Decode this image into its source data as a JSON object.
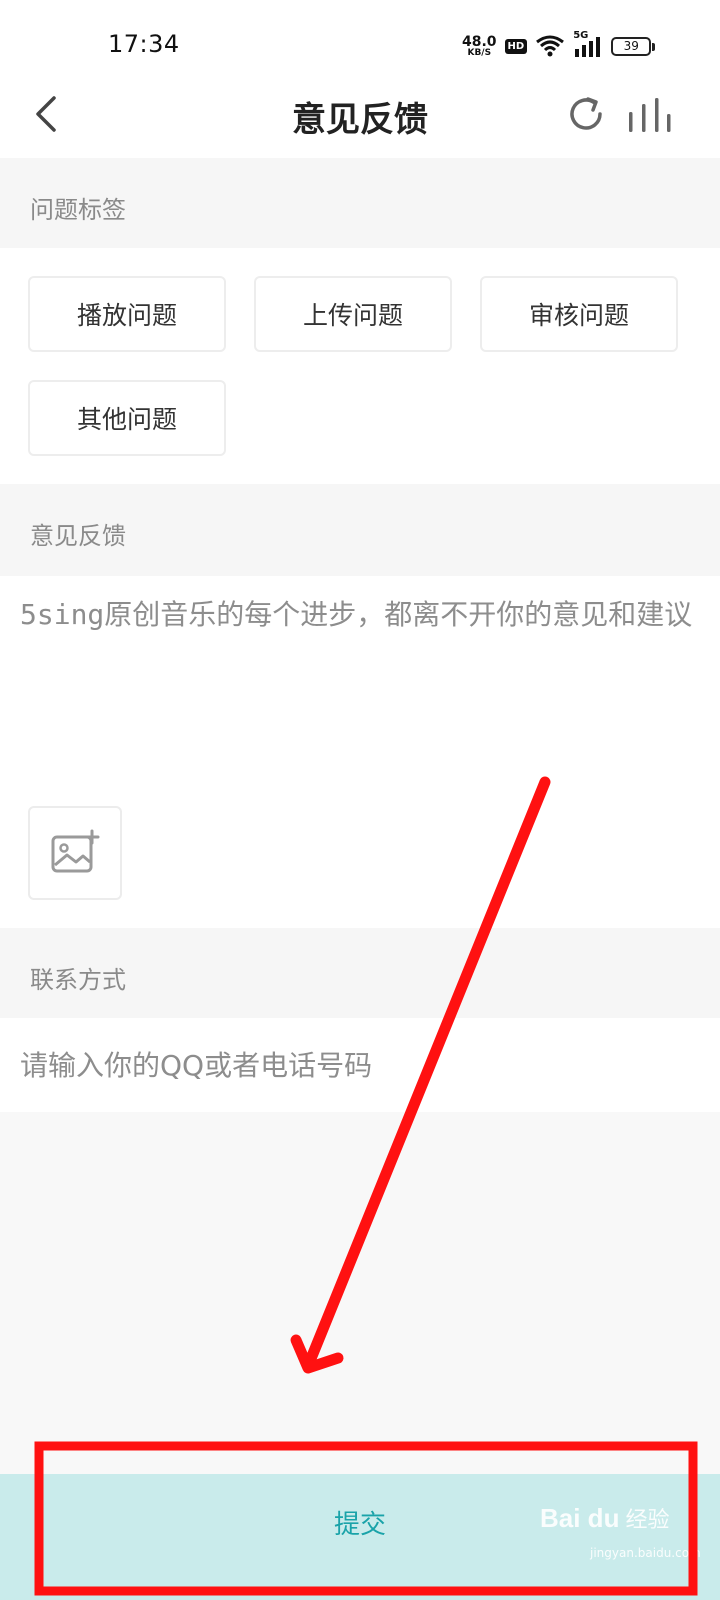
{
  "status_bar": {
    "time": "17:34",
    "net_speed_value": "48.0",
    "net_speed_unit": "KB/S",
    "hd_label": "HD",
    "signal_label": "5G",
    "battery_level": "39"
  },
  "nav": {
    "title": "意见反馈",
    "back_icon": "chevron-left-icon",
    "refresh_icon": "refresh-icon",
    "equalizer_icon": "equalizer-icon"
  },
  "tags_section": {
    "header": "问题标签",
    "tags": [
      "播放问题",
      "上传问题",
      "审核问题",
      "其他问题"
    ]
  },
  "feedback_section": {
    "header": "意见反馈",
    "placeholder": "5sing原创音乐的每个进步，都离不开你的意见和建议",
    "image_add_icon": "add-image-icon"
  },
  "contact_section": {
    "header": "联系方式",
    "placeholder": "请输入你的QQ或者电话号码"
  },
  "submit": {
    "label": "提交"
  },
  "watermark": {
    "logo": "Bai du",
    "text": "经验",
    "url": "jingyan.baidu.com"
  },
  "colors": {
    "accent": "#1aa3a9",
    "submit_bg": "#c9ebeb",
    "annotation_red": "#ff1111"
  }
}
